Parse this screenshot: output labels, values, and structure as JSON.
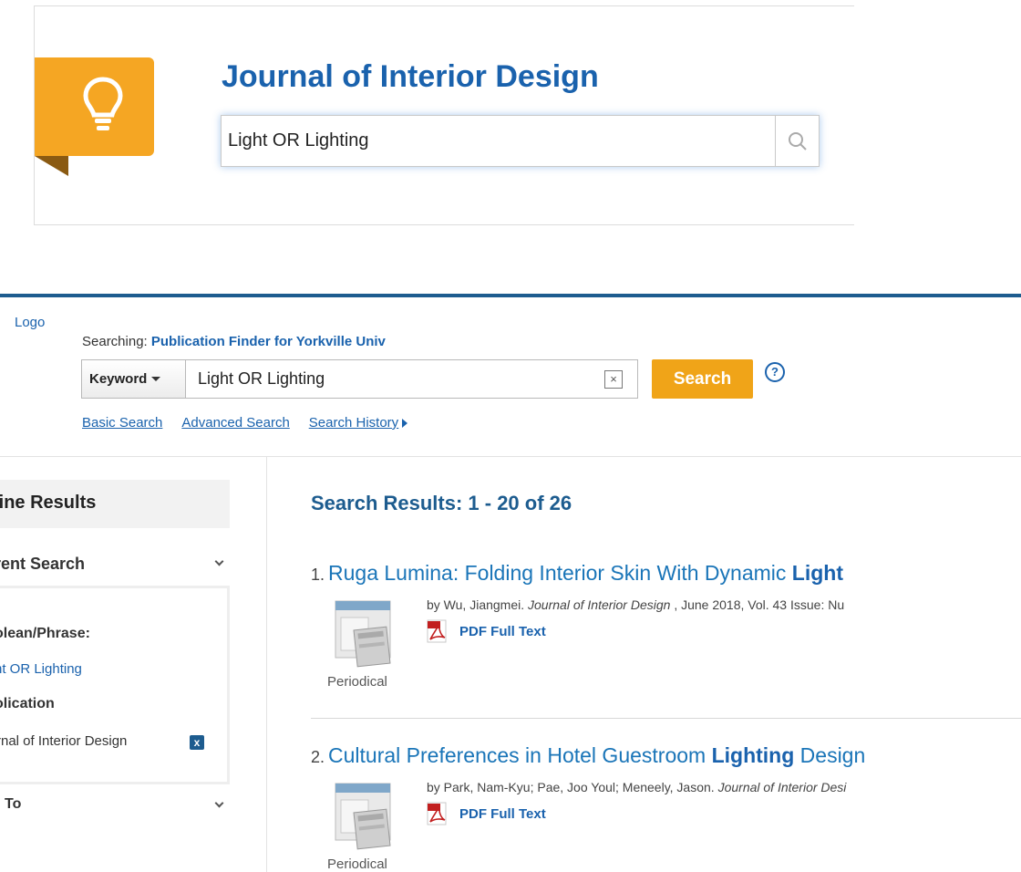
{
  "top_panel": {
    "icon": "lightbulb-icon",
    "title": "Journal of Interior Design",
    "search_value": "Light OR Lighting",
    "search_icon": "magnifier-icon"
  },
  "header": {
    "logo_text": "Logo",
    "searching_label": "Searching:",
    "searching_target": "Publication Finder for Yorkville Univ",
    "field_select": "Keyword",
    "query": "Light OR Lighting",
    "clear_label": "×",
    "search_button": "Search",
    "help_label": "?",
    "links": [
      "Basic Search",
      "Advanced Search",
      "Search History"
    ]
  },
  "sidebar": {
    "refine_title": "fine Results",
    "current_search_title": "rent Search",
    "boolean_label": "olean/Phrase:",
    "boolean_value": "ht OR Lighting",
    "publication_label": "olication",
    "publication_value": "rnal of Interior Design",
    "remove_label": "x",
    "limit_to_title": "To"
  },
  "results": {
    "heading": "Search Results: 1 - 20 of 26",
    "items": [
      {
        "num": "1.",
        "title_pre": "Ruga Lumina: Folding Interior Skin With Dynamic ",
        "title_hl": "Light",
        "title_post": "",
        "by_pre": "by Wu, Jiangmei. ",
        "journal": "Journal of Interior Design",
        "by_post": " , June 2018, Vol. 43 Issue: Nu",
        "link": "PDF Full Text",
        "type": "Periodical"
      },
      {
        "num": "2.",
        "title_pre": "Cultural Preferences in Hotel Guestroom ",
        "title_hl": "Lighting",
        "title_post": " Design",
        "by_pre": "by Park, Nam-Kyu; Pae, Joo Youl; Meneely, Jason. ",
        "journal": "Journal of Interior Desi",
        "by_post": "",
        "link": "PDF Full Text",
        "type": "Periodical"
      }
    ]
  }
}
